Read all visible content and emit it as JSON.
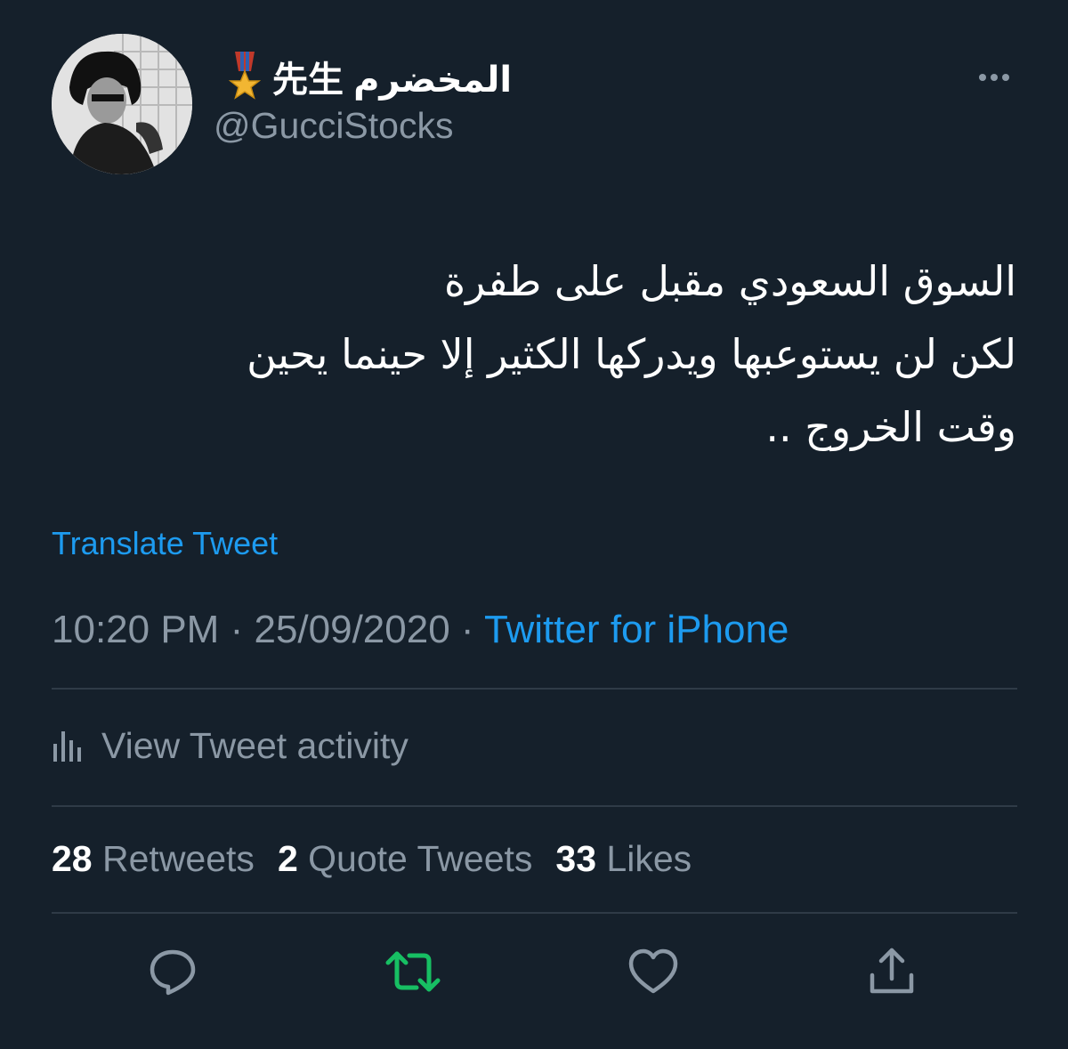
{
  "tweet": {
    "display_name": "المخضرم 先生",
    "handle": "@GucciStocks",
    "text_lines": [
      "السوق السعودي مقبل على طفرة",
      "لكن لن يستوعبها ويدركها الكثير إلا حينما يحين",
      "وقت الخروج .."
    ],
    "translate_label": "Translate Tweet",
    "time": "10:20 PM",
    "date": "25/09/2020",
    "separator": "·",
    "source": "Twitter for iPhone",
    "activity_label": "View Tweet activity",
    "retweets_count": "28",
    "retweets_label": "Retweets",
    "quotes_count": "2",
    "quotes_label": "Quote Tweets",
    "likes_count": "33",
    "likes_label": "Likes"
  },
  "icons": {
    "badge": "military-medal-icon",
    "more": "more-dots-icon",
    "activity": "bar-chart-icon",
    "reply": "reply-icon",
    "retweet": "retweet-icon",
    "like": "heart-icon",
    "share": "share-icon"
  },
  "colors": {
    "background": "#15202b",
    "primary_text": "#ffffff",
    "secondary_text": "#8b98a5",
    "accent_blue": "#1d9bf0",
    "retweet_green": "#17bf63",
    "divider": "#2f3b47"
  }
}
